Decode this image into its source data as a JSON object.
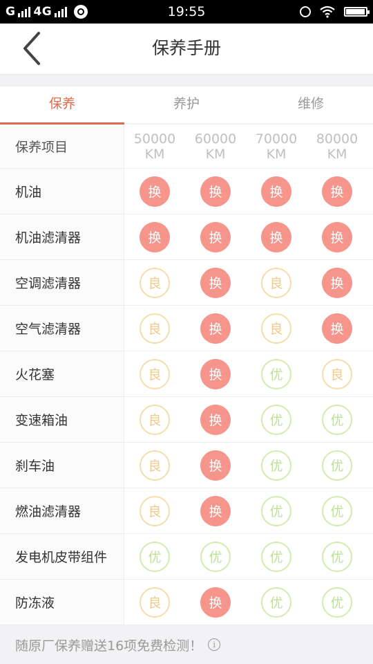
{
  "status_bar": {
    "carrier": "G",
    "network": "4G",
    "time": "19:55",
    "battery_level": 0.95
  },
  "header": {
    "title": "保养手册"
  },
  "tabs": [
    {
      "label": "保养",
      "active": true
    },
    {
      "label": "养护",
      "active": false
    },
    {
      "label": "维修",
      "active": false
    }
  ],
  "table": {
    "header_label": "保养项目",
    "columns": [
      {
        "value": "50000",
        "unit": "KM"
      },
      {
        "value": "60000",
        "unit": "KM"
      },
      {
        "value": "70000",
        "unit": "KM"
      },
      {
        "value": "80000",
        "unit": "KM"
      }
    ],
    "status_labels": {
      "replace": "换",
      "good": "良",
      "excellent": "优"
    },
    "rows": [
      {
        "item": "机油",
        "statuses": [
          "replace",
          "replace",
          "replace",
          "replace"
        ]
      },
      {
        "item": "机油滤清器",
        "statuses": [
          "replace",
          "replace",
          "replace",
          "replace"
        ]
      },
      {
        "item": "空调滤清器",
        "statuses": [
          "good",
          "replace",
          "good",
          "replace"
        ]
      },
      {
        "item": "空气滤清器",
        "statuses": [
          "good",
          "replace",
          "good",
          "replace"
        ]
      },
      {
        "item": "火花塞",
        "statuses": [
          "good",
          "replace",
          "excellent",
          "good"
        ]
      },
      {
        "item": "变速箱油",
        "statuses": [
          "good",
          "replace",
          "excellent",
          "excellent"
        ]
      },
      {
        "item": "刹车油",
        "statuses": [
          "good",
          "replace",
          "excellent",
          "excellent"
        ]
      },
      {
        "item": "燃油滤清器",
        "statuses": [
          "good",
          "replace",
          "excellent",
          "excellent"
        ]
      },
      {
        "item": "发电机皮带组件",
        "statuses": [
          "excellent",
          "excellent",
          "excellent",
          "excellent"
        ]
      },
      {
        "item": "防冻液",
        "statuses": [
          "good",
          "replace",
          "excellent",
          "excellent"
        ]
      }
    ]
  },
  "footer": {
    "text": "随原厂保养赠送16项免费检测！",
    "icon": "info-icon"
  },
  "colors": {
    "accent": "#e0694d",
    "replace": "#f5958c",
    "good": "#f1c98a",
    "excellent": "#bfe09a"
  }
}
